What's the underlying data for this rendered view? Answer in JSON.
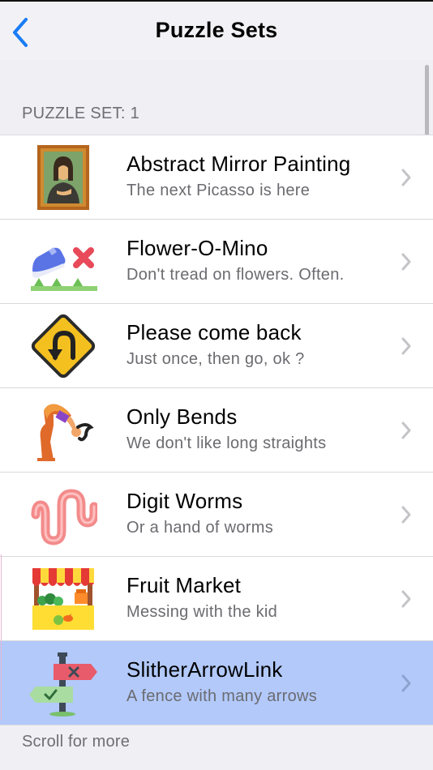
{
  "nav": {
    "title": "Puzzle Sets",
    "back_icon": "chevron-left-icon",
    "accent_color": "#1a7cf5"
  },
  "section": {
    "header": "PUZZLE SET: 1"
  },
  "items": [
    {
      "title": "Abstract Mirror Painting",
      "subtitle": "The next Picasso is here",
      "icon": "framed-painting-icon",
      "selected": false
    },
    {
      "title": "Flower-O-Mino",
      "subtitle": "Don't tread on flowers. Often.",
      "icon": "sneaker-on-grass-icon",
      "selected": false
    },
    {
      "title": "Please come back",
      "subtitle": "Just once, then go, ok ?",
      "icon": "u-turn-sign-icon",
      "selected": false
    },
    {
      "title": "Only Bends",
      "subtitle": "We don't like long straights",
      "icon": "bending-person-icon",
      "selected": false
    },
    {
      "title": "Digit Worms",
      "subtitle": "Or a hand of worms",
      "icon": "worm-icon",
      "selected": false
    },
    {
      "title": "Fruit Market",
      "subtitle": "Messing with the kid",
      "icon": "market-stall-icon",
      "selected": false
    },
    {
      "title": "SlitherArrowLink",
      "subtitle": "A fence with many arrows",
      "icon": "signpost-icon",
      "selected": true
    }
  ],
  "footer": {
    "text": "Scroll for more"
  },
  "colors": {
    "selected_row": "#b2c9fa",
    "background": "#efeff4"
  }
}
